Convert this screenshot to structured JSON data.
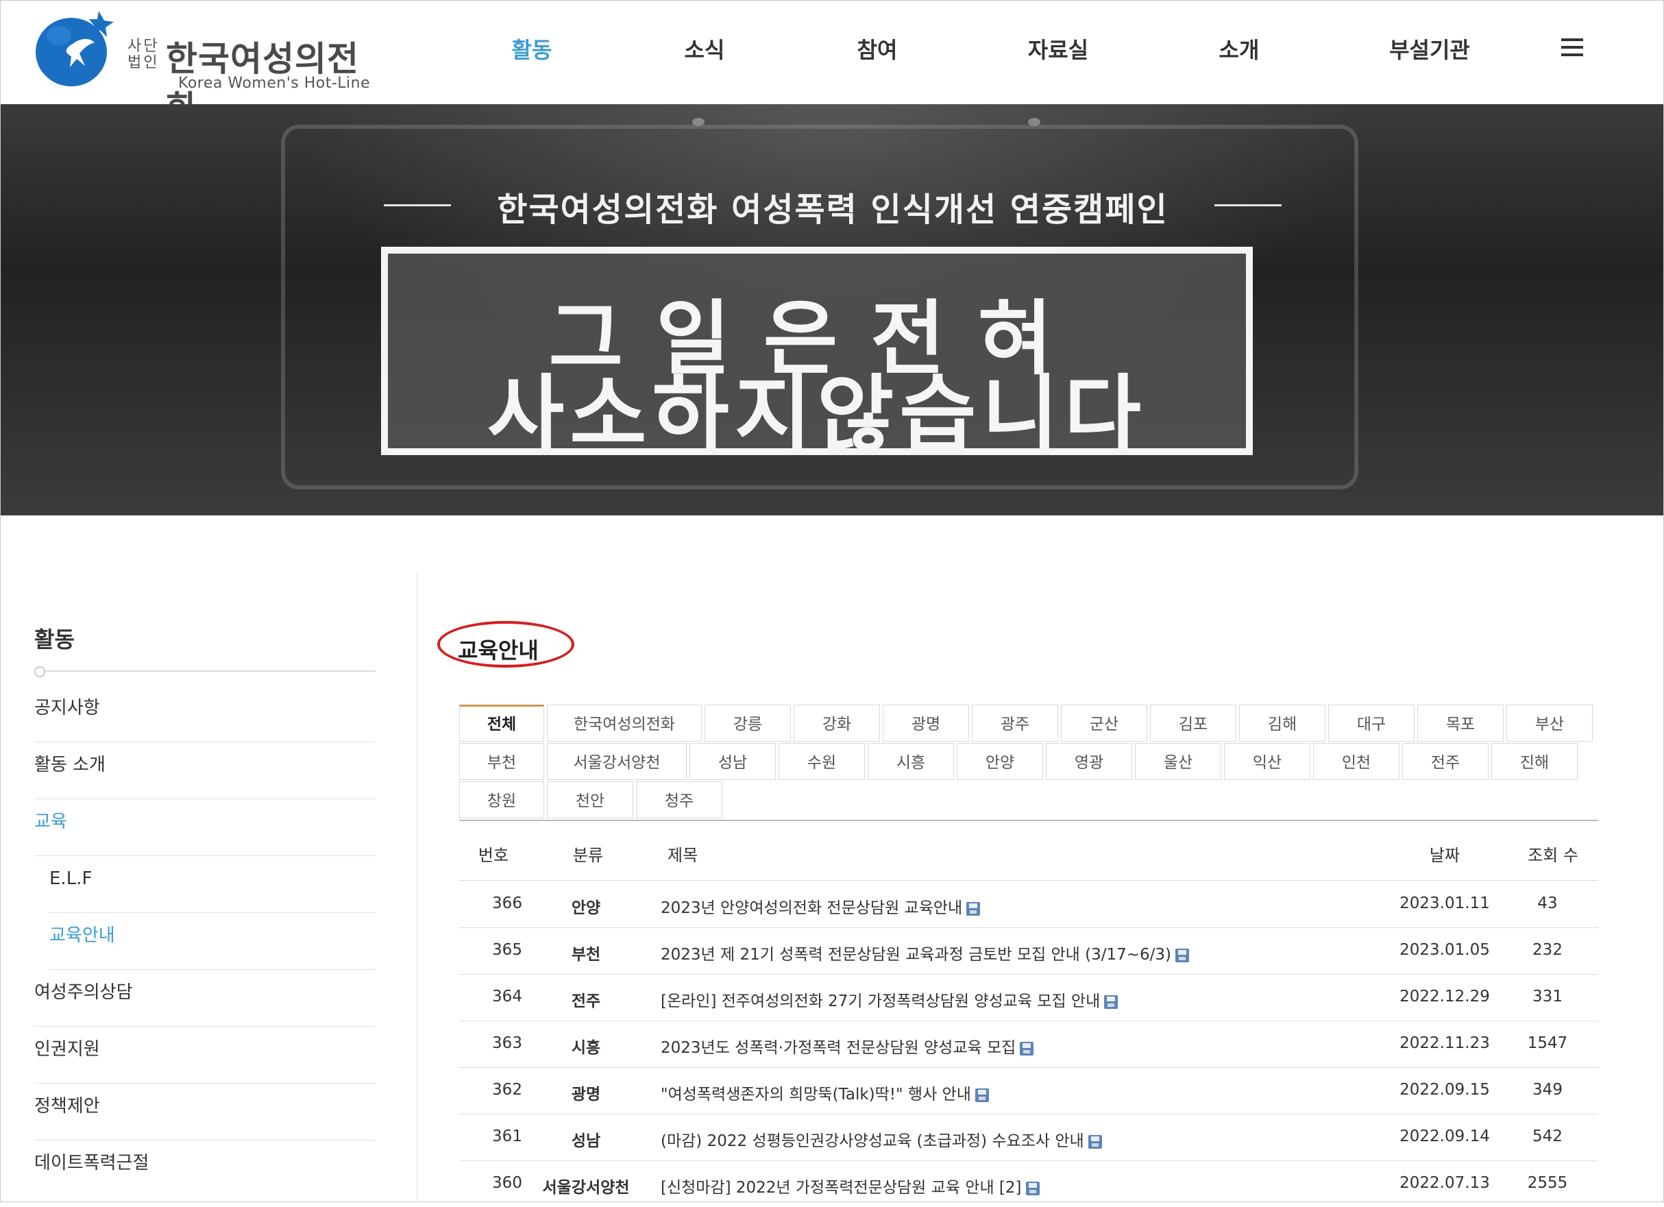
{
  "header": {
    "logo_corp": "사단 법인",
    "logo_name": "한국여성의전화",
    "logo_eng": "Korea Women's Hot-Line",
    "nav": [
      "활동",
      "소식",
      "참여",
      "자료실",
      "소개",
      "부설기관"
    ],
    "active_nav": "활동"
  },
  "banner": {
    "subtitle": "한국여성의전화 여성폭력 인식개선 연중캠페인",
    "row1": "그일은전혀",
    "row2": "사소하지않습니다"
  },
  "sidebar": {
    "title": "활동",
    "items": [
      {
        "label": "공지사항"
      },
      {
        "label": "활동 소개"
      },
      {
        "label": "교육"
      },
      {
        "label": "E.L.F"
      },
      {
        "label": "교육안내"
      },
      {
        "label": "여성주의상담"
      },
      {
        "label": "인권지원"
      },
      {
        "label": "정책제안"
      },
      {
        "label": "데이트폭력근절"
      }
    ]
  },
  "content": {
    "page_title": "교육안내",
    "tabs": [
      "전체",
      "한국여성의전화",
      "강릉",
      "강화",
      "광명",
      "광주",
      "군산",
      "김포",
      "김해",
      "대구",
      "목포",
      "부산",
      "부천",
      "서울강서양천",
      "성남",
      "수원",
      "시흥",
      "안양",
      "영광",
      "울산",
      "익산",
      "인천",
      "전주",
      "진해",
      "창원",
      "천안",
      "청주"
    ],
    "active_tab": "전체",
    "columns": {
      "no": "번호",
      "category": "분류",
      "title": "제목",
      "date": "날짜",
      "views": "조회 수"
    },
    "rows": [
      {
        "no": "366",
        "category": "안양",
        "title": "2023년 안양여성의전화 전문상담원 교육안내",
        "date": "2023.01.11",
        "views": "43"
      },
      {
        "no": "365",
        "category": "부천",
        "title": "2023년 제 21기 성폭력 전문상담원 교육과정 금토반 모집 안내 (3/17~6/3)",
        "date": "2023.01.05",
        "views": "232"
      },
      {
        "no": "364",
        "category": "전주",
        "title": "[온라인] 전주여성의전화 27기 가정폭력상담원 양성교육 모집 안내",
        "date": "2022.12.29",
        "views": "331"
      },
      {
        "no": "363",
        "category": "시흥",
        "title": "2023년도 성폭력·가정폭력 전문상담원 양성교육 모집",
        "date": "2022.11.23",
        "views": "1547"
      },
      {
        "no": "362",
        "category": "광명",
        "title": "\"여성폭력생존자의 희망뚝(Talk)딱!\" 행사 안내",
        "date": "2022.09.15",
        "views": "349"
      },
      {
        "no": "361",
        "category": "성남",
        "title": "(마감) 2022 성평등인권강사양성교육 (초급과정) 수요조사 안내",
        "date": "2022.09.14",
        "views": "542"
      },
      {
        "no": "360",
        "category": "서울강서양천",
        "title": "[신청마감] 2022년 가정폭력전문상담원 교육 안내 [2]",
        "date": "2022.07.13",
        "views": "2555"
      }
    ]
  },
  "colors": {
    "accent": "#3b9cd2",
    "logo_blue": "#1a6fc2",
    "highlight_circle": "#d51e1e",
    "tab_active_border": "#c89a55"
  }
}
